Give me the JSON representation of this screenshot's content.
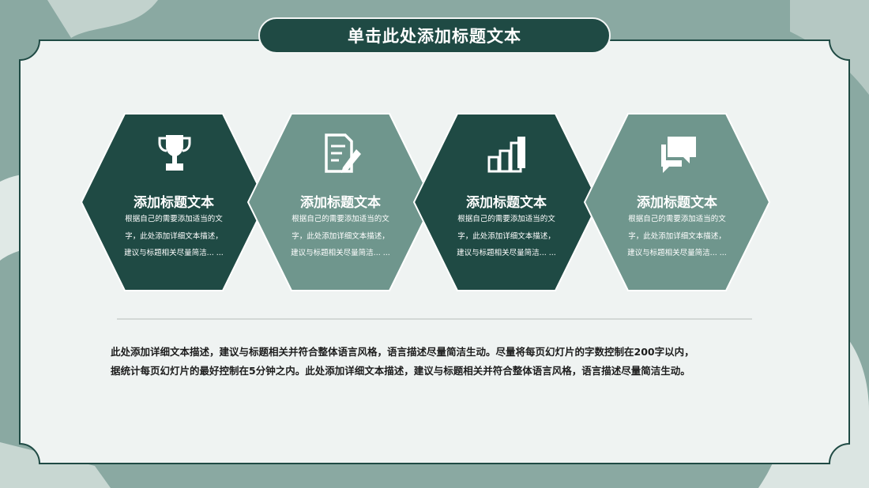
{
  "slide": {
    "title": "单击此处添加标题文本",
    "colors": {
      "dark": "#1f4a44",
      "light": "#6f968d",
      "frame": "#1f4a44",
      "panel": "#eff3f2",
      "bg": "#8aa9a2"
    },
    "cards": [
      {
        "icon": "trophy-icon",
        "title": "添加标题文本",
        "body": "根据自己的需要添加适当的文字，此处添加详细文本描述，建议与标题相关尽量简洁... ..."
      },
      {
        "icon": "document-pen-icon",
        "title": "添加标题文本",
        "body": "根据自己的需要添加适当的文字，此处添加详细文本描述，建议与标题相关尽量简洁... ..."
      },
      {
        "icon": "bar-chart-icon",
        "title": "添加标题文本",
        "body": "根据自己的需要添加适当的文字，此处添加详细文本描述，建议与标题相关尽量简洁... ..."
      },
      {
        "icon": "chat-bubbles-icon",
        "title": "添加标题文本",
        "body": "根据自己的需要添加适当的文字，此处添加详细文本描述，建议与标题相关尽量简洁... ..."
      }
    ],
    "description_line1": "此处添加详细文本描述，建议与标题相关并符合整体语言风格，语言描述尽量简洁生动。尽量将每页幻灯片的字数控制在200字以内，",
    "description_line2": "据统计每页幻灯片的最好控制在5分钟之内。此处添加详细文本描述，建议与标题相关并符合整体语言风格，语言描述尽量简洁生动。"
  }
}
